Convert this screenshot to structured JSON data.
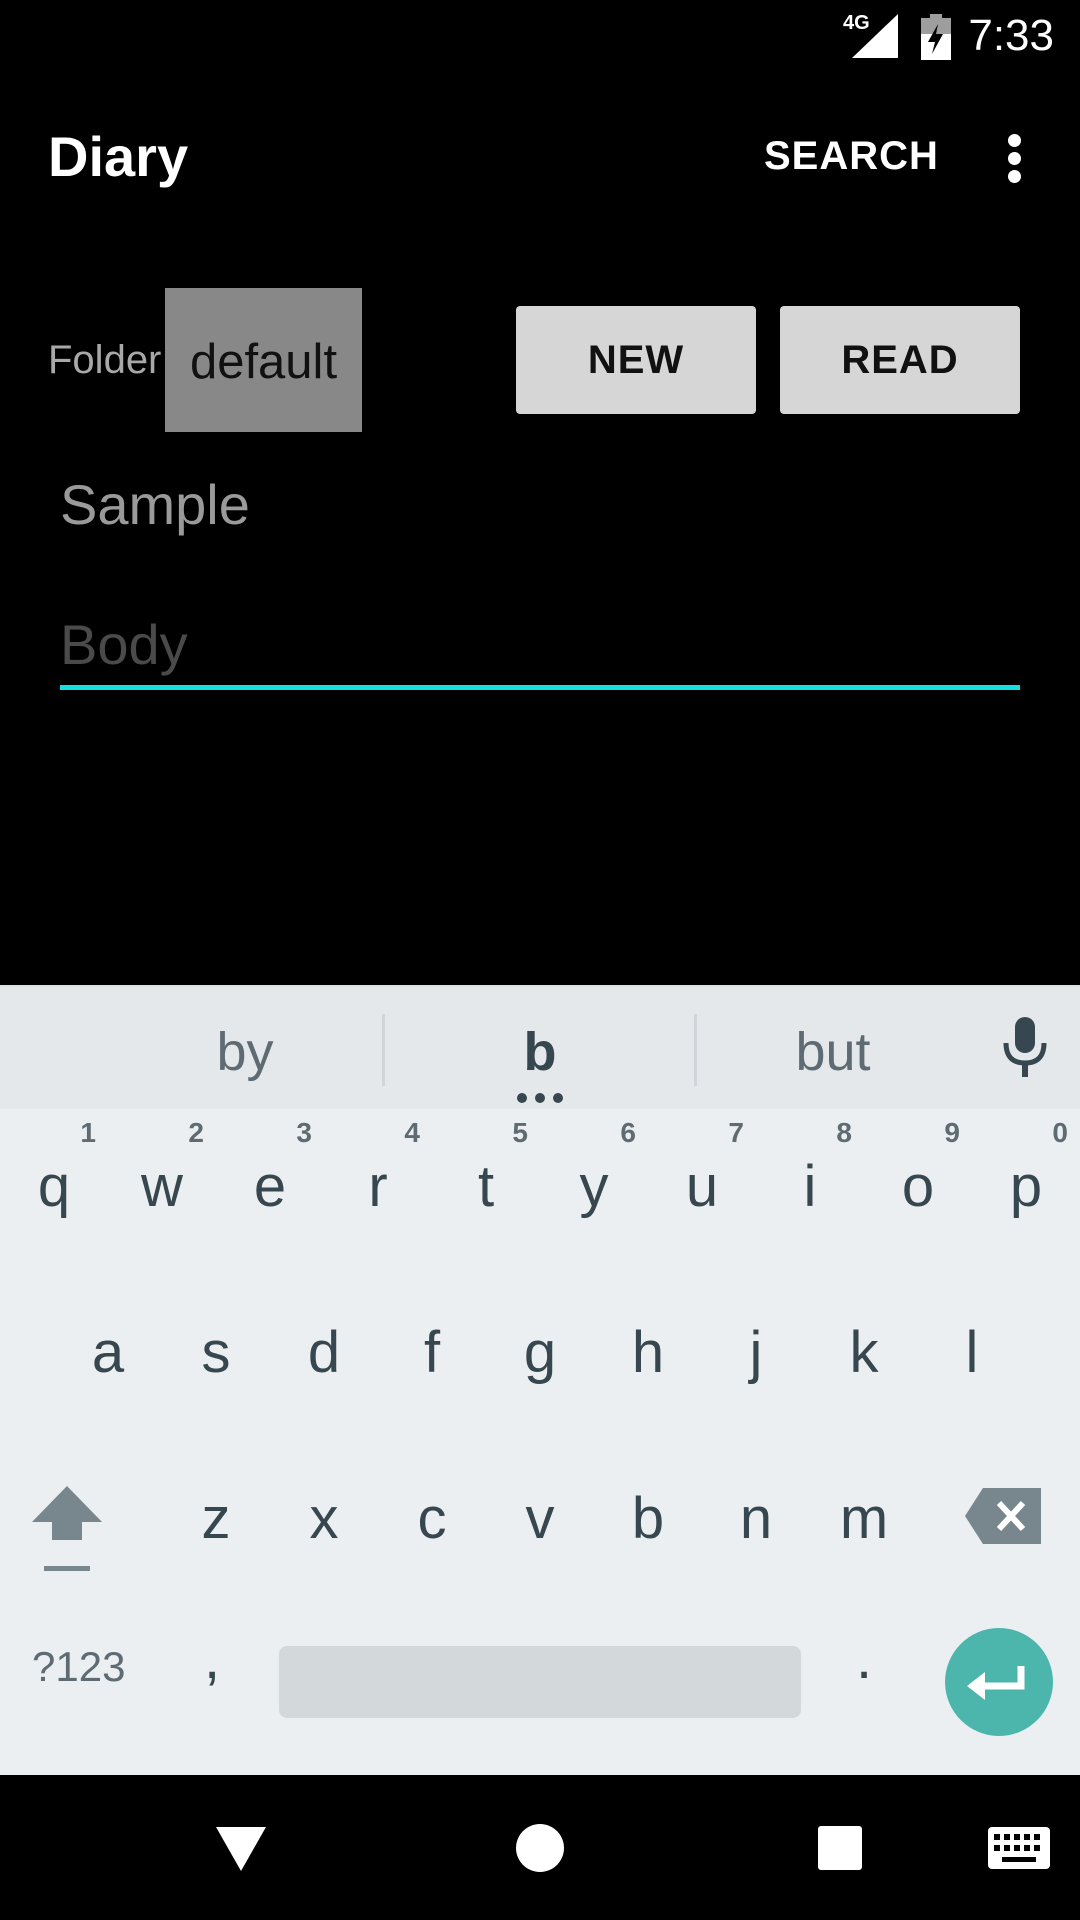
{
  "status_bar": {
    "network": "4G",
    "time": "7:33"
  },
  "app_bar": {
    "title": "Diary",
    "search_label": "SEARCH"
  },
  "folder": {
    "label": "Folder",
    "value": "default"
  },
  "buttons": {
    "new_label": "NEW",
    "read_label": "READ"
  },
  "fields": {
    "subject_value": "Sample",
    "body_placeholder": "Body"
  },
  "keyboard": {
    "suggestions": [
      "by",
      "b",
      "but"
    ],
    "row1": [
      {
        "key": "q",
        "hint": "1"
      },
      {
        "key": "w",
        "hint": "2"
      },
      {
        "key": "e",
        "hint": "3"
      },
      {
        "key": "r",
        "hint": "4"
      },
      {
        "key": "t",
        "hint": "5"
      },
      {
        "key": "y",
        "hint": "6"
      },
      {
        "key": "u",
        "hint": "7"
      },
      {
        "key": "i",
        "hint": "8"
      },
      {
        "key": "o",
        "hint": "9"
      },
      {
        "key": "p",
        "hint": "0"
      }
    ],
    "row2": [
      "a",
      "s",
      "d",
      "f",
      "g",
      "h",
      "j",
      "k",
      "l"
    ],
    "row3": [
      "z",
      "x",
      "c",
      "v",
      "b",
      "n",
      "m"
    ],
    "symbols_label": "?123",
    "comma": ",",
    "period": "."
  },
  "colors": {
    "accent": "#15e0e0",
    "enter_key": "#4db6ac",
    "keyboard_bg": "#eceff1"
  },
  "icons": [
    "signal-icon",
    "battery-charging-icon",
    "overflow-menu-icon",
    "mic-icon",
    "shift-icon",
    "backspace-icon",
    "enter-icon",
    "back-icon",
    "home-icon",
    "recents-icon",
    "keyboard-icon"
  ]
}
